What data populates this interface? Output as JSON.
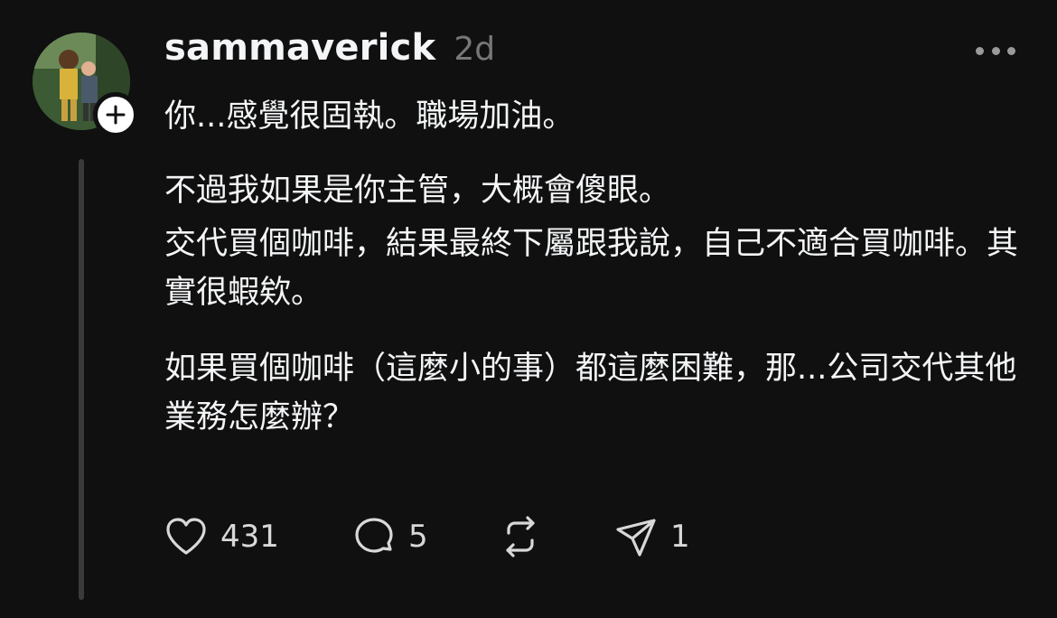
{
  "post": {
    "username": "sammaverick",
    "timestamp": "2d",
    "paragraphs": [
      "你...感覺很固執。職場加油。",
      "不過我如果是你主管，大概會傻眼。",
      "交代買個咖啡，結果最終下屬跟我說，自己不適合買咖啡。其實很蝦欸。",
      "如果買個咖啡（這麼小的事）都這麼困難，那...公司交代其他業務怎麼辦？"
    ],
    "avatar_icon": "user-avatar-photo",
    "follow_icon": "plus-icon",
    "more_icon": "more-horizontal-icon"
  },
  "actions": {
    "like": {
      "icon": "heart-icon",
      "count": "431"
    },
    "reply": {
      "icon": "comment-icon",
      "count": "5"
    },
    "repost": {
      "icon": "repost-icon",
      "count": ""
    },
    "share": {
      "icon": "send-icon",
      "count": "1"
    }
  },
  "colors": {
    "background": "#101010",
    "text": "#f3f5f7",
    "muted": "#777777",
    "thread_line": "#3a3a3a"
  }
}
